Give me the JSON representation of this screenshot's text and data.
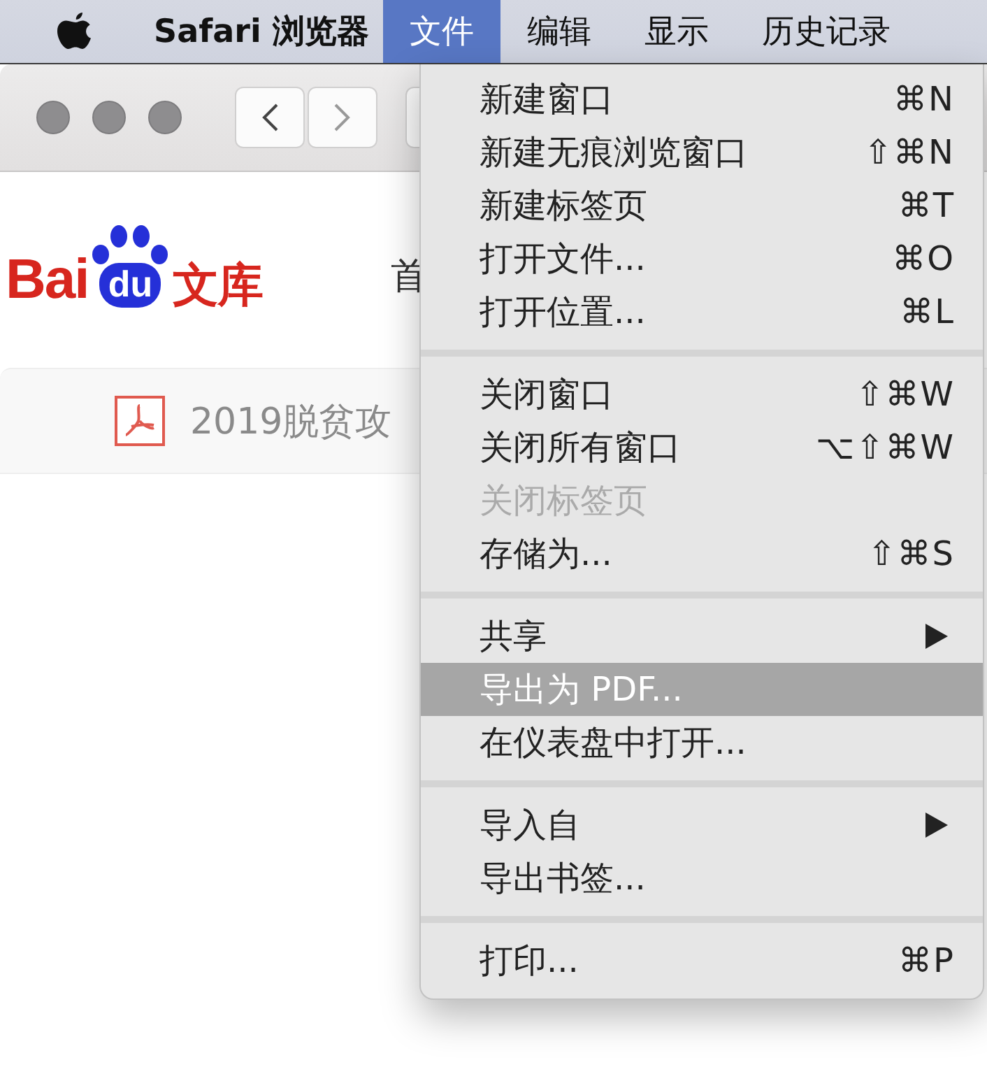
{
  "menu_bar": {
    "items": [
      {
        "label": "Safari 浏览器",
        "kind": "app",
        "selected": false
      },
      {
        "label": "文件",
        "kind": "menu",
        "selected": true
      },
      {
        "label": "编辑",
        "kind": "menu",
        "selected": false
      },
      {
        "label": "显示",
        "kind": "menu",
        "selected": false
      },
      {
        "label": "历史记录",
        "kind": "menu",
        "selected": false
      }
    ]
  },
  "browser": {
    "logo": {
      "prefix": "Bai",
      "paw": "du",
      "suffix": "文库"
    },
    "nav_item": "首",
    "document_title": "2019脱贫攻"
  },
  "file_menu": {
    "sections": [
      [
        {
          "label": "新建窗口",
          "shortcut": "⌘N",
          "disabled": false,
          "selected": false,
          "submenu": false
        },
        {
          "label": "新建无痕浏览窗口",
          "shortcut": "⇧⌘N",
          "disabled": false,
          "selected": false,
          "submenu": false
        },
        {
          "label": "新建标签页",
          "shortcut": "⌘T",
          "disabled": false,
          "selected": false,
          "submenu": false
        },
        {
          "label": "打开文件...",
          "shortcut": "⌘O",
          "disabled": false,
          "selected": false,
          "submenu": false
        },
        {
          "label": "打开位置...",
          "shortcut": "⌘L",
          "disabled": false,
          "selected": false,
          "submenu": false
        }
      ],
      [
        {
          "label": "关闭窗口",
          "shortcut": "⇧⌘W",
          "disabled": false,
          "selected": false,
          "submenu": false
        },
        {
          "label": "关闭所有窗口",
          "shortcut": "⌥⇧⌘W",
          "disabled": false,
          "selected": false,
          "submenu": false
        },
        {
          "label": "关闭标签页",
          "disabled": true,
          "selected": false,
          "submenu": false
        },
        {
          "label": "存储为...",
          "shortcut": "⇧⌘S",
          "disabled": false,
          "selected": false,
          "submenu": false
        }
      ],
      [
        {
          "label": "共享",
          "disabled": false,
          "selected": false,
          "submenu": true
        },
        {
          "label": "导出为 PDF...",
          "disabled": false,
          "selected": true,
          "submenu": false
        },
        {
          "label": "在仪表盘中打开...",
          "disabled": false,
          "selected": false,
          "submenu": false
        }
      ],
      [
        {
          "label": "导入自",
          "disabled": false,
          "selected": false,
          "submenu": true
        },
        {
          "label": "导出书签...",
          "disabled": false,
          "selected": false,
          "submenu": false
        }
      ],
      [
        {
          "label": "打印...",
          "shortcut": "⌘P",
          "disabled": false,
          "selected": false,
          "submenu": false
        }
      ]
    ]
  }
}
